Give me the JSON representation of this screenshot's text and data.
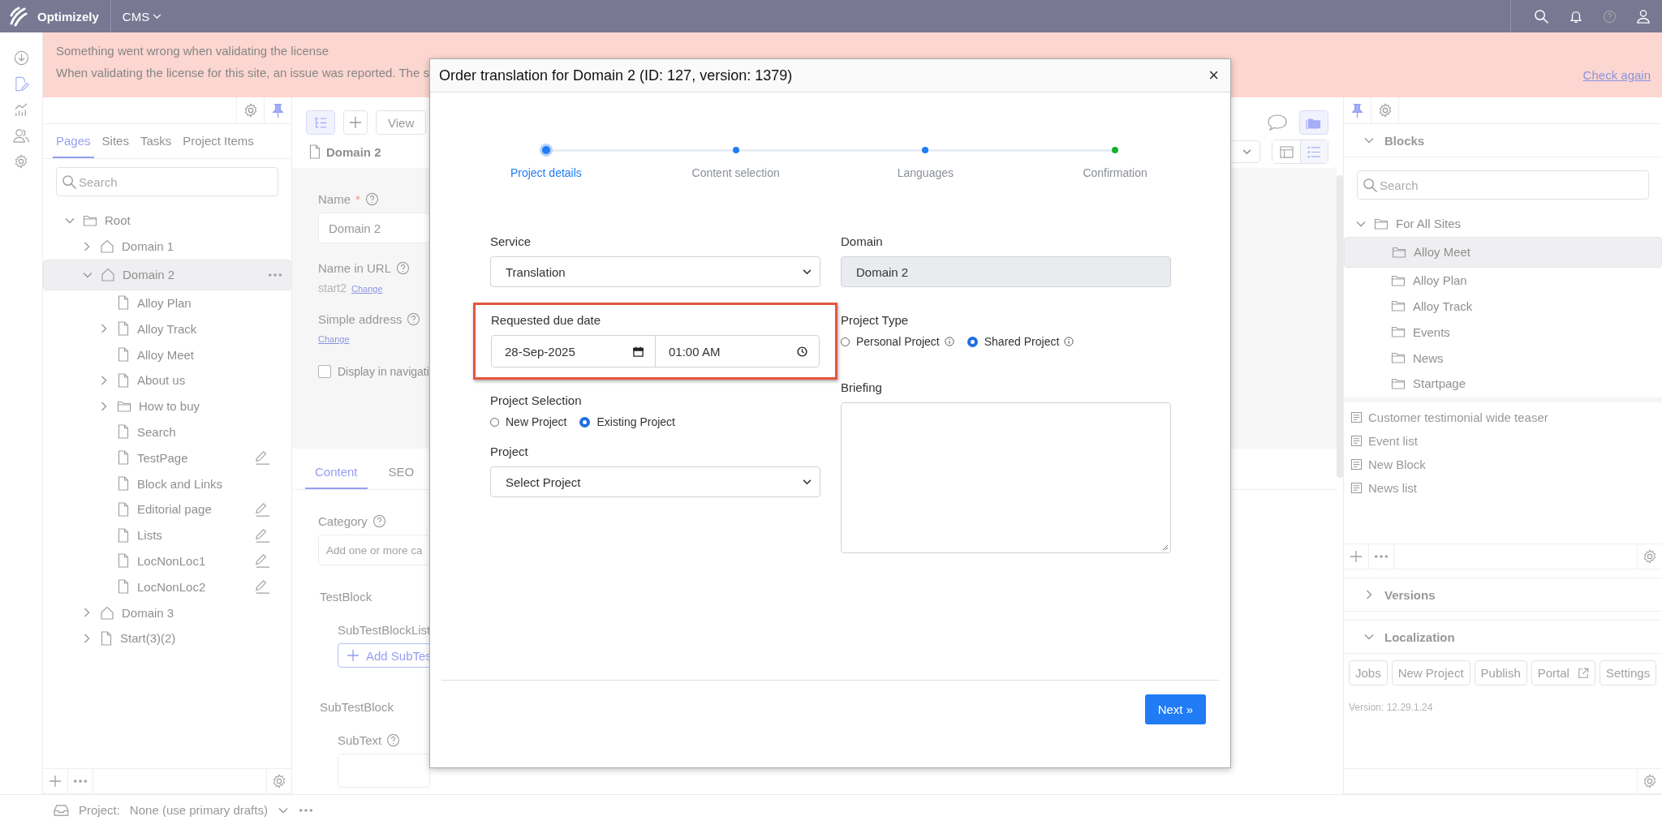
{
  "top_bar": {
    "product": "Optimizely",
    "menu": "CMS"
  },
  "license_banner": {
    "title": "Something went wrong when validating the license",
    "message": "When validating the license for this site, an issue was reported. The s",
    "action": "Check again"
  },
  "navigation_panel": {
    "tabs": [
      {
        "label": "Pages",
        "selected": true
      },
      {
        "label": "Sites",
        "selected": false
      },
      {
        "label": "Tasks",
        "selected": false
      },
      {
        "label": "Project Items",
        "selected": false
      }
    ],
    "search_placeholder": "Search",
    "tree": [
      {
        "label": "Root",
        "kind": "folder",
        "has_children": true,
        "expanded": true,
        "selected": false,
        "edited": false,
        "children": [
          {
            "label": "Domain 1",
            "kind": "house",
            "has_children": true,
            "expanded": false,
            "selected": false,
            "edited": false
          },
          {
            "label": "Domain 2",
            "kind": "house",
            "has_children": true,
            "expanded": true,
            "selected": true,
            "edited": false,
            "children": [
              {
                "label": "Alloy Plan",
                "kind": "page",
                "has_children": false,
                "selected": false,
                "edited": false
              },
              {
                "label": "Alloy Track",
                "kind": "page",
                "has_children": true,
                "expanded": false,
                "selected": false,
                "edited": false
              },
              {
                "label": "Alloy Meet",
                "kind": "page",
                "has_children": false,
                "selected": false,
                "edited": false
              },
              {
                "label": "About us",
                "kind": "page",
                "has_children": true,
                "expanded": false,
                "selected": false,
                "edited": false
              },
              {
                "label": "How to buy",
                "kind": "folder",
                "has_children": true,
                "expanded": false,
                "selected": false,
                "edited": false
              },
              {
                "label": "Search",
                "kind": "page",
                "has_children": false,
                "selected": false,
                "edited": false
              },
              {
                "label": "TestPage",
                "kind": "page",
                "has_children": false,
                "selected": false,
                "edited": true
              },
              {
                "label": "Block and Links",
                "kind": "page",
                "has_children": false,
                "selected": false,
                "edited": false
              },
              {
                "label": "Editorial page",
                "kind": "page",
                "has_children": false,
                "selected": false,
                "edited": true
              },
              {
                "label": "Lists",
                "kind": "page",
                "has_children": false,
                "selected": false,
                "edited": true
              },
              {
                "label": "LocNonLoc1",
                "kind": "page",
                "has_children": false,
                "selected": false,
                "edited": true
              },
              {
                "label": "LocNonLoc2",
                "kind": "page",
                "has_children": false,
                "selected": false,
                "edited": true
              }
            ]
          },
          {
            "label": "Domain 3",
            "kind": "house",
            "has_children": true,
            "expanded": false,
            "selected": false,
            "edited": false
          },
          {
            "label": "Start(3)(2)",
            "kind": "page",
            "has_children": true,
            "expanded": false,
            "selected": false,
            "edited": false
          }
        ]
      }
    ]
  },
  "editor": {
    "view_button": "View",
    "page_title": "Domain 2",
    "name_label": "Name",
    "required_mark": "*",
    "name_value": "Domain 2",
    "url_label": "Name in URL",
    "url_value": "start2",
    "url_change": "Change",
    "address_label": "Simple address",
    "address_change": "Change",
    "display_in_navigation": {
      "label": "Display in navigati",
      "checked": false
    },
    "tabs": [
      {
        "label": "Content",
        "selected": true
      },
      {
        "label": "SEO",
        "selected": false
      }
    ],
    "category_label": "Category",
    "category_placeholder": "Add one or more ca",
    "test_block_heading": "TestBlock",
    "list_label": "SubTestBlockList",
    "add_button": "Add SubTes",
    "sub_block_heading": "SubTestBlock",
    "sub_text_label": "SubText"
  },
  "assets_panel": {
    "blocks": {
      "title": "Blocks",
      "expanded": true,
      "search_placeholder": "Search",
      "tree": [
        {
          "label": "For All Sites",
          "kind": "folder",
          "has_children": true,
          "expanded": true,
          "selected": false,
          "children": [
            {
              "label": "Alloy Meet",
              "kind": "folder",
              "has_children": false,
              "selected": true
            },
            {
              "label": "Alloy Plan",
              "kind": "folder",
              "has_children": false,
              "selected": false
            },
            {
              "label": "Alloy Track",
              "kind": "folder",
              "has_children": false,
              "selected": false
            },
            {
              "label": "Events",
              "kind": "folder",
              "has_children": false,
              "selected": false
            },
            {
              "label": "News",
              "kind": "folder",
              "has_children": false,
              "selected": false
            },
            {
              "label": "Startpage",
              "kind": "folder",
              "has_children": false,
              "selected": false
            }
          ]
        }
      ],
      "items": [
        "Customer testimonial wide teaser",
        "Event list",
        "New Block",
        "News list"
      ]
    },
    "versions": {
      "title": "Versions",
      "expanded": false
    },
    "localization": {
      "title": "Localization",
      "expanded": true,
      "buttons": [
        {
          "label": "Jobs",
          "external": false
        },
        {
          "label": "New Project",
          "external": false
        },
        {
          "label": "Publish",
          "external": false
        },
        {
          "label": "Portal",
          "external": true
        },
        {
          "label": "Settings",
          "external": false
        }
      ],
      "version": "Version: 12.29.1.24"
    }
  },
  "bottom_bar": {
    "project_label": "Project:",
    "project_value": "None (use primary drafts)"
  },
  "dialog": {
    "title": "Order translation for Domain 2 (ID: 127, version: 1379)",
    "close": "×",
    "steps": [
      {
        "label": "Project details",
        "selected": true,
        "color": "#1f7cf5"
      },
      {
        "label": "Content selection",
        "selected": false,
        "color": "#1f7cf5"
      },
      {
        "label": "Languages",
        "selected": false,
        "color": "#1f7cf5"
      },
      {
        "label": "Confirmation",
        "selected": false,
        "color": "#16b32a"
      }
    ],
    "service": {
      "label": "Service",
      "value": "Translation"
    },
    "domain": {
      "label": "Domain",
      "value": "Domain 2"
    },
    "due_date": {
      "label": "Requested due date",
      "date": "28-Sep-2025",
      "time": "01:00 AM",
      "highlighted": true
    },
    "project_type": {
      "label": "Project Type",
      "options": [
        {
          "label": "Personal Project",
          "selected": false
        },
        {
          "label": "Shared Project",
          "selected": true
        }
      ]
    },
    "project_selection": {
      "label": "Project Selection",
      "options": [
        {
          "label": "New Project",
          "selected": false
        },
        {
          "label": "Existing Project",
          "selected": true
        }
      ]
    },
    "project": {
      "label": "Project",
      "value": "Select Project"
    },
    "briefing": {
      "label": "Briefing"
    },
    "next_button": "Next »"
  }
}
